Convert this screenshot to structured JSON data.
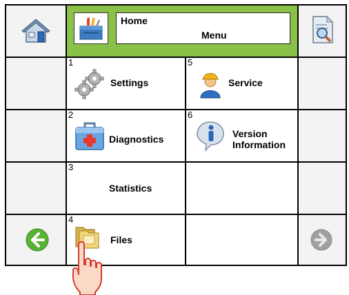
{
  "header": {
    "title": "Home",
    "subtitle": "Menu"
  },
  "menu": {
    "settings": {
      "number": "1",
      "label": "Settings"
    },
    "diagnostics": {
      "number": "2",
      "label": "Diagnostics"
    },
    "statistics": {
      "number": "3",
      "label": "Statistics"
    },
    "files": {
      "number": "4",
      "label": "Files"
    },
    "service": {
      "number": "5",
      "label": "Service"
    },
    "version": {
      "number": "6",
      "label_line1": "Version",
      "label_line2": "Information"
    }
  },
  "colors": {
    "header_green": "#8ac149",
    "back_arrow": "#5ab234",
    "next_arrow_disabled": "#a0a0a0"
  },
  "icons": [
    "home-icon",
    "toolbox-icon",
    "preview-icon",
    "gears-icon",
    "first-aid-kit-icon",
    "folders-icon",
    "service-person-icon",
    "info-icon",
    "back-arrow-icon",
    "next-arrow-icon",
    "pointing-hand-icon"
  ]
}
